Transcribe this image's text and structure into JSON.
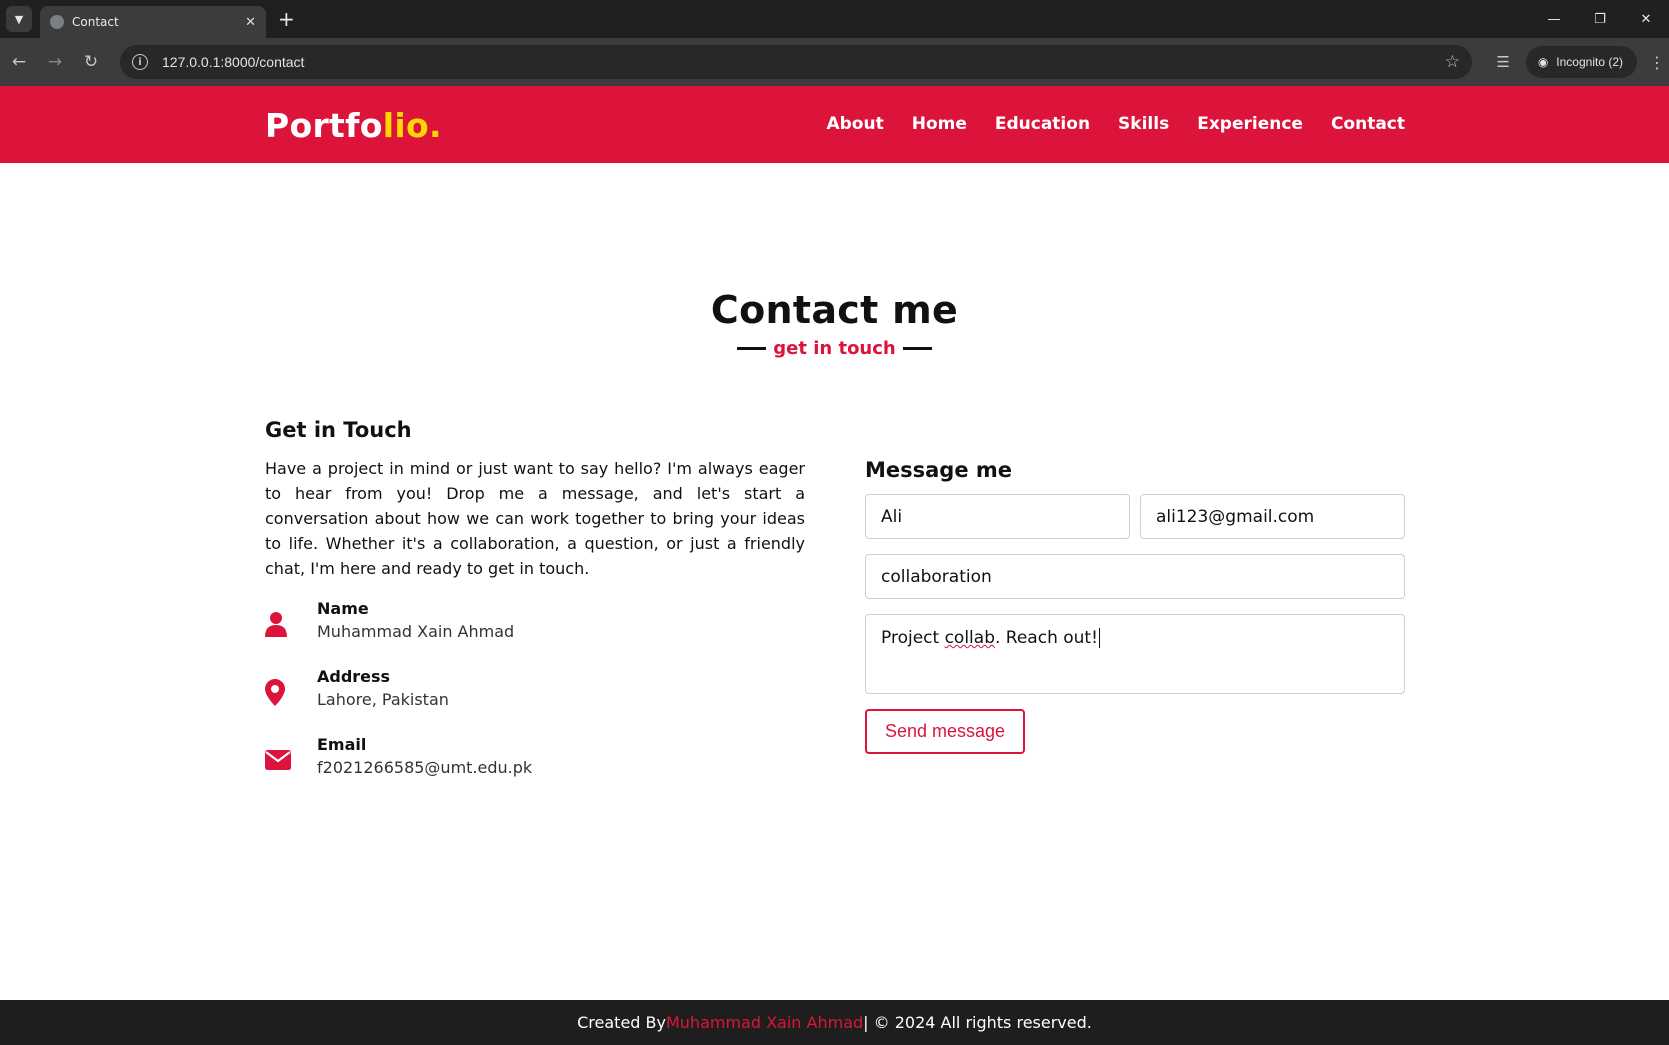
{
  "browser": {
    "tab_title": "Contact",
    "url": "127.0.0.1:8000/contact",
    "incognito_label": "Incognito (2)"
  },
  "header": {
    "logo_main": "Portfo",
    "logo_accent": "lio.",
    "nav": [
      "About",
      "Home",
      "Education",
      "Skills",
      "Experience",
      "Contact"
    ]
  },
  "section": {
    "title": "Contact me",
    "subtitle": "get in touch"
  },
  "get_in_touch": {
    "heading": "Get in Touch",
    "text": "Have a project in mind or just want to say hello? I'm always eager to hear from you! Drop me a message, and let's start a conversation about how we can work together to bring your ideas to life. Whether it's a collaboration, a question, or just a friendly chat, I'm here and ready to get in touch.",
    "items": [
      {
        "label": "Name",
        "value": "Muhammad Xain Ahmad",
        "icon": "user-icon"
      },
      {
        "label": "Address",
        "value": "Lahore, Pakistan",
        "icon": "map-marker-icon"
      },
      {
        "label": "Email",
        "value": "f2021266585@umt.edu.pk",
        "icon": "envelope-icon"
      }
    ]
  },
  "form": {
    "heading": "Message me",
    "name_value": "Ali",
    "email_value": "ali123@gmail.com",
    "subject_value": "collaboration",
    "message_part1": "Project ",
    "message_misspelled": "collab",
    "message_part2": ". Reach out!",
    "send_label": "Send message"
  },
  "footer": {
    "prefix": "Created By ",
    "author": "Muhammad Xain Ahmad",
    "suffix": " | © 2024 All rights reserved."
  },
  "colors": {
    "brand": "#dc143c",
    "logo_accent": "#ffd700",
    "footer_bg": "#1e1e1e"
  }
}
